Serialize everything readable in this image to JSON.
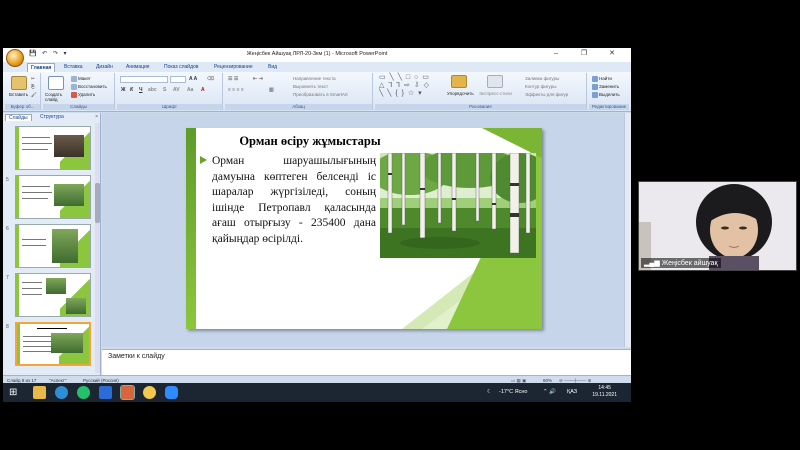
{
  "window": {
    "title": "Жеңісбек Айшуақ ЛРЛ-20-3км (1) - Microsoft PowerPoint",
    "controls": [
      "–",
      "❐",
      "✕"
    ]
  },
  "ribbon": {
    "tabs": [
      "Главная",
      "Вставка",
      "Дизайн",
      "Анимация",
      "Показ слайдов",
      "Рецензирование",
      "Вид"
    ],
    "active_tab": "Главная",
    "groups": {
      "clipboard": {
        "label": "Буфер об...",
        "paste": "Вставить"
      },
      "slides": {
        "label": "Слайды",
        "new_slide": "Создать слайд",
        "layout": "Макет",
        "reset": "Восстановить",
        "delete": "Удалить"
      },
      "font": {
        "label": "Шрифт"
      },
      "paragraph": {
        "label": "Абзац",
        "text_direction": "Направление текста",
        "align_text": "Выровнять текст",
        "smartart": "Преобразовать в SmartArt"
      },
      "drawing": {
        "label": "Рисование",
        "arrange": "Упорядочить",
        "quick_styles": "Экспресс-стили",
        "shape_fill": "Заливка фигуры",
        "shape_outline": "Контур фигуры",
        "shape_effects": "Эффекты для фигур"
      },
      "editing": {
        "label": "Редактирование",
        "find": "Найти",
        "replace": "Заменить",
        "select": "Выделить"
      }
    }
  },
  "left_pane": {
    "tabs": [
      "Слайды",
      "Структура"
    ],
    "close": "×",
    "slide_numbers": [
      "",
      "5",
      "6",
      "7",
      "8"
    ]
  },
  "slide": {
    "title": "Орман өсіру жұмыстары",
    "body": "Орман шаруашылығының дамуына көптеген белсенді іс шаралар жүргізіледі, соның ішінде Петропавл қаласында ағаш отырғызу - 235400 дана қайыңдар өсірілді."
  },
  "notes": {
    "placeholder": "Заметки к слайду"
  },
  "status_bar": {
    "slide": "Слайд 8 из 17",
    "theme": "\"Аспект\"",
    "language": "Русский (Россия)",
    "zoom": "60%"
  },
  "webcam": {
    "name": "Жеңісбек айшуақ"
  },
  "taskbar": {
    "weather": "-17°C Ясно",
    "language": "ҚАЗ",
    "time": "14:45",
    "date": "19.11.2021"
  }
}
